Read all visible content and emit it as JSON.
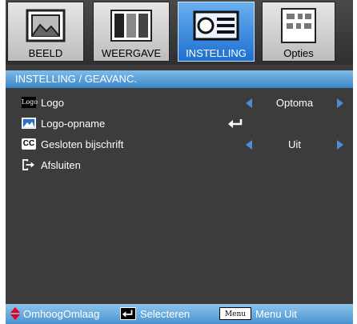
{
  "tabs": [
    {
      "label": "BEELD",
      "icon": "image-icon",
      "active": false
    },
    {
      "label": "WEERGAVE",
      "icon": "display-icon",
      "active": false
    },
    {
      "label": "INSTELLING",
      "icon": "projector-icon",
      "active": true
    },
    {
      "label": "Opties",
      "icon": "options-icon",
      "active": false
    }
  ],
  "breadcrumb": "INSTELLING / GEAVANC.",
  "menu": {
    "logo": {
      "label": "Logo",
      "value": "Optoma",
      "icon_text": "Logo"
    },
    "logo_capture": {
      "label": "Logo-opname"
    },
    "closed_caption": {
      "label": "Gesloten bijschrift",
      "value": "Uit",
      "icon_text": "CC"
    },
    "exit": {
      "label": "Afsluiten"
    }
  },
  "footer": {
    "updown_label": "OmhoogOmlaag",
    "select_label": "Selecteren",
    "menu_key": "Menu",
    "menu_label": "Menu Uit"
  },
  "colors": {
    "active_tab": "#1d6fd0",
    "breadcrumb_bar": "#3a86c7",
    "panel": "#3c3c3c",
    "arrow": "#4a90d9"
  }
}
